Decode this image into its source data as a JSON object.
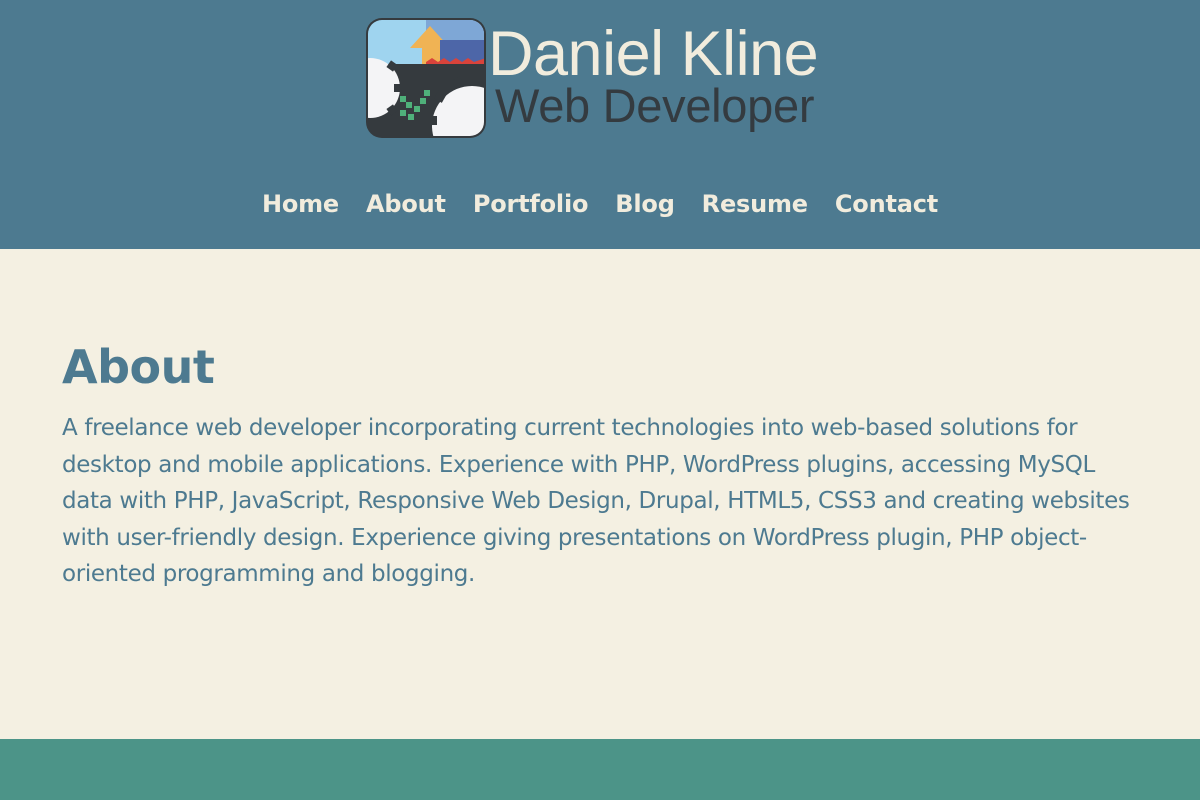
{
  "header": {
    "logo": {
      "name": "Daniel Kline",
      "title": "Web Developer",
      "icon": "gears-arrow-logo-icon"
    },
    "nav": [
      {
        "label": "Home"
      },
      {
        "label": "About"
      },
      {
        "label": "Portfolio"
      },
      {
        "label": "Blog"
      },
      {
        "label": "Resume"
      },
      {
        "label": "Contact"
      }
    ]
  },
  "main": {
    "title": "About",
    "body": "A freelance web developer incorporating current technologies into web-based solutions for desktop and mobile applications. Experience with PHP, WordPress plugins, accessing MySQL data with PHP, JavaScript, Responsive Web Design, Drupal, HTML5, CSS3 and creating websites with user-friendly design. Experience giving presentations on WordPress plugin, PHP object-oriented programming and blogging."
  },
  "colors": {
    "header_bg": "#4d7a90",
    "main_bg": "#f4f0e2",
    "footer_bg": "#4c9488",
    "nav_text": "#f1ecdd",
    "heading_text": "#4d7a90",
    "logo_title_text": "#343b40"
  }
}
